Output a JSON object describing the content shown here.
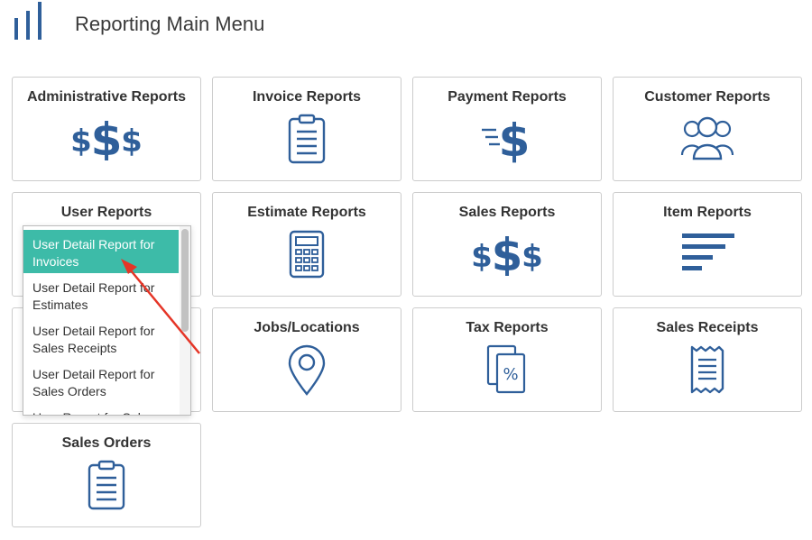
{
  "header": {
    "title": "Reporting Main Menu",
    "logo": "bar-logo-icon"
  },
  "colors": {
    "icon": "#2f5f9a",
    "accent": "#3dbba8",
    "arrow": "#e53527"
  },
  "cards": [
    {
      "label": "Administrative Reports",
      "icon": "dollar-signs-icon"
    },
    {
      "label": "Invoice Reports",
      "icon": "clipboard-icon"
    },
    {
      "label": "Payment Reports",
      "icon": "fast-dollar-icon"
    },
    {
      "label": "Customer Reports",
      "icon": "users-icon"
    },
    {
      "label": "User Reports",
      "icon": "none"
    },
    {
      "label": "Estimate Reports",
      "icon": "calculator-icon"
    },
    {
      "label": "Sales Reports",
      "icon": "dollar-signs-icon"
    },
    {
      "label": "Item Reports",
      "icon": "bars-icon"
    },
    {
      "label": "Jobs/Locations",
      "icon": "location-pin-icon"
    },
    {
      "label": "Tax Reports",
      "icon": "tax-document-icon"
    },
    {
      "label": "Sales Receipts",
      "icon": "receipt-icon"
    },
    {
      "label": "Sales Orders",
      "icon": "clipboard-icon"
    }
  ],
  "user_reports_menu": {
    "items": [
      {
        "label": "User Detail Report for Invoices",
        "selected": true
      },
      {
        "label": "User Detail Report for Estimates",
        "selected": false
      },
      {
        "label": "User Detail Report for Sales Receipts",
        "selected": false
      },
      {
        "label": "User Detail Report for Sales Orders",
        "selected": false
      },
      {
        "label": "User Report for Sales",
        "selected": false
      }
    ]
  }
}
